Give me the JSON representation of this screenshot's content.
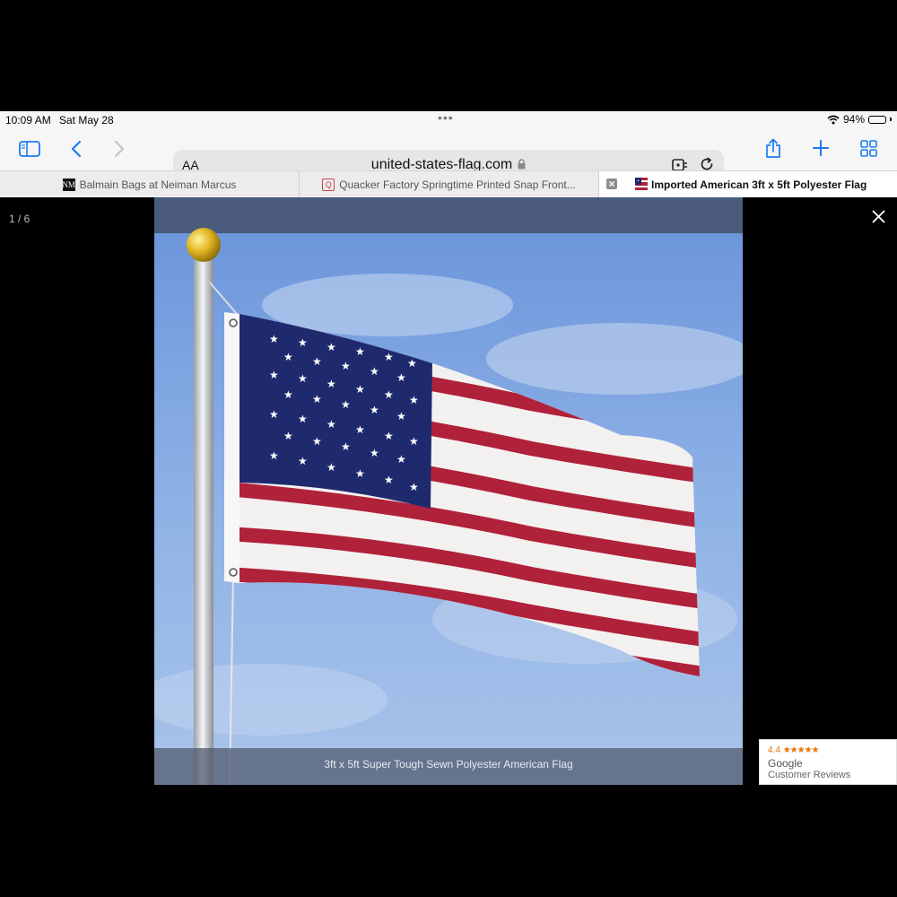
{
  "status": {
    "time": "10:09 AM",
    "date": "Sat May 28",
    "battery": "94%",
    "battery_level": 0.94,
    "dots": "•••"
  },
  "toolbar": {
    "sidebar_icon": "sidebar-icon",
    "back_icon": "chevron-left-icon",
    "forward_icon": "chevron-right-icon",
    "reader_label": "AA",
    "url": "united-states-flag.com",
    "share_icon": "share-icon",
    "new_tab_icon": "plus-icon",
    "tabs_icon": "grid-icon"
  },
  "tabs": [
    {
      "label": "Balmain Bags at Neiman Marcus",
      "favicon": "NM"
    },
    {
      "label": "Quacker Factory Springtime Printed Snap Front...",
      "favicon": "Q"
    },
    {
      "label": "Imported American 3ft x 5ft Polyester Flag",
      "favicon": "flag"
    }
  ],
  "viewer": {
    "counter": "1 / 6",
    "caption": "3ft x 5ft Super Tough Sewn Polyester American Flag"
  },
  "google_badge": {
    "rating": "4.4",
    "stars": "★★★★★",
    "name": "Google",
    "sub": "Customer Reviews"
  },
  "colors": {
    "accent": "#1a7cf0",
    "flag_red": "#b0213a",
    "flag_blue": "#1f2a6e",
    "sky": "#7ea6e2"
  }
}
